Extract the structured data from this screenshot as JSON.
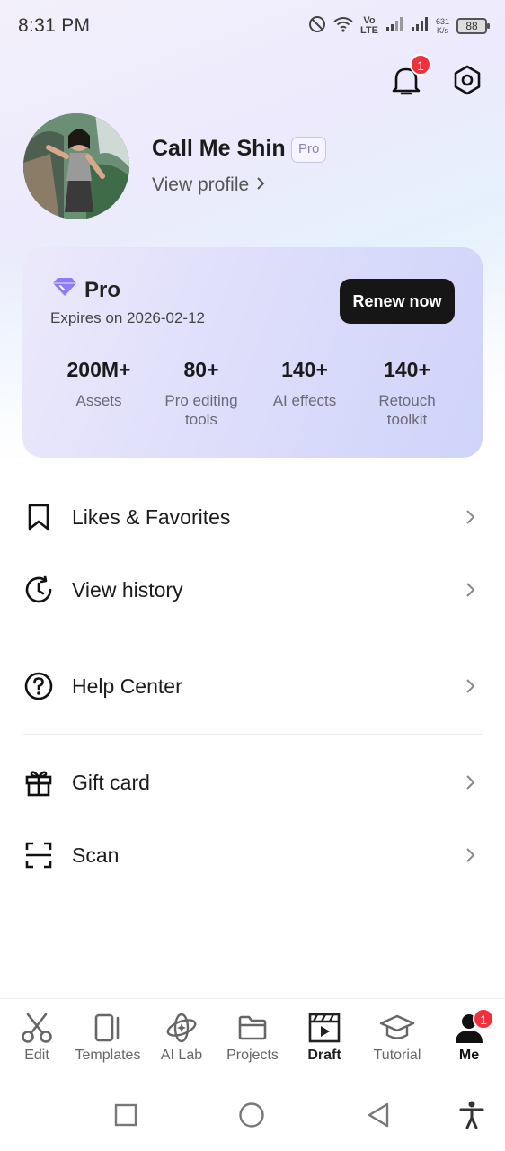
{
  "status_bar": {
    "time": "8:31 PM",
    "network_top": "Vo",
    "network_bottom": "LTE",
    "speed_top": "631",
    "speed_bottom": "K/s",
    "battery": "88"
  },
  "header": {
    "notification_count": "1"
  },
  "profile": {
    "name": "Call Me Shin",
    "tag": "Pro",
    "view_profile_label": "View profile"
  },
  "pro_card": {
    "title": "Pro",
    "expires": "Expires on 2026-02-12",
    "renew_label": "Renew now",
    "stats": [
      {
        "value": "200M+",
        "label": "Assets"
      },
      {
        "value": "80+",
        "label": "Pro editing tools"
      },
      {
        "value": "140+",
        "label": "AI effects"
      },
      {
        "value": "140+",
        "label": "Retouch toolkit"
      }
    ]
  },
  "menu": {
    "items": [
      {
        "label": "Likes & Favorites",
        "icon": "bookmark-icon"
      },
      {
        "label": "View history",
        "icon": "history-icon"
      },
      {
        "label": "Help Center",
        "icon": "help-icon"
      },
      {
        "label": "Gift card",
        "icon": "gift-icon"
      },
      {
        "label": "Scan",
        "icon": "scan-icon"
      }
    ]
  },
  "bottom_nav": {
    "items": [
      {
        "label": "Edit",
        "icon": "scissors-icon"
      },
      {
        "label": "Templates",
        "icon": "templates-icon"
      },
      {
        "label": "AI Lab",
        "icon": "ai-lab-icon"
      },
      {
        "label": "Projects",
        "icon": "folder-icon"
      },
      {
        "label": "Draft",
        "icon": "clapperboard-icon"
      },
      {
        "label": "Tutorial",
        "icon": "graduation-cap-icon"
      },
      {
        "label": "Me",
        "icon": "person-icon"
      }
    ],
    "me_badge": "1",
    "active": "Me"
  },
  "colors": {
    "accent_purple": "#7b6cf0",
    "badge_red": "#f0313d",
    "button_dark": "#161616"
  }
}
